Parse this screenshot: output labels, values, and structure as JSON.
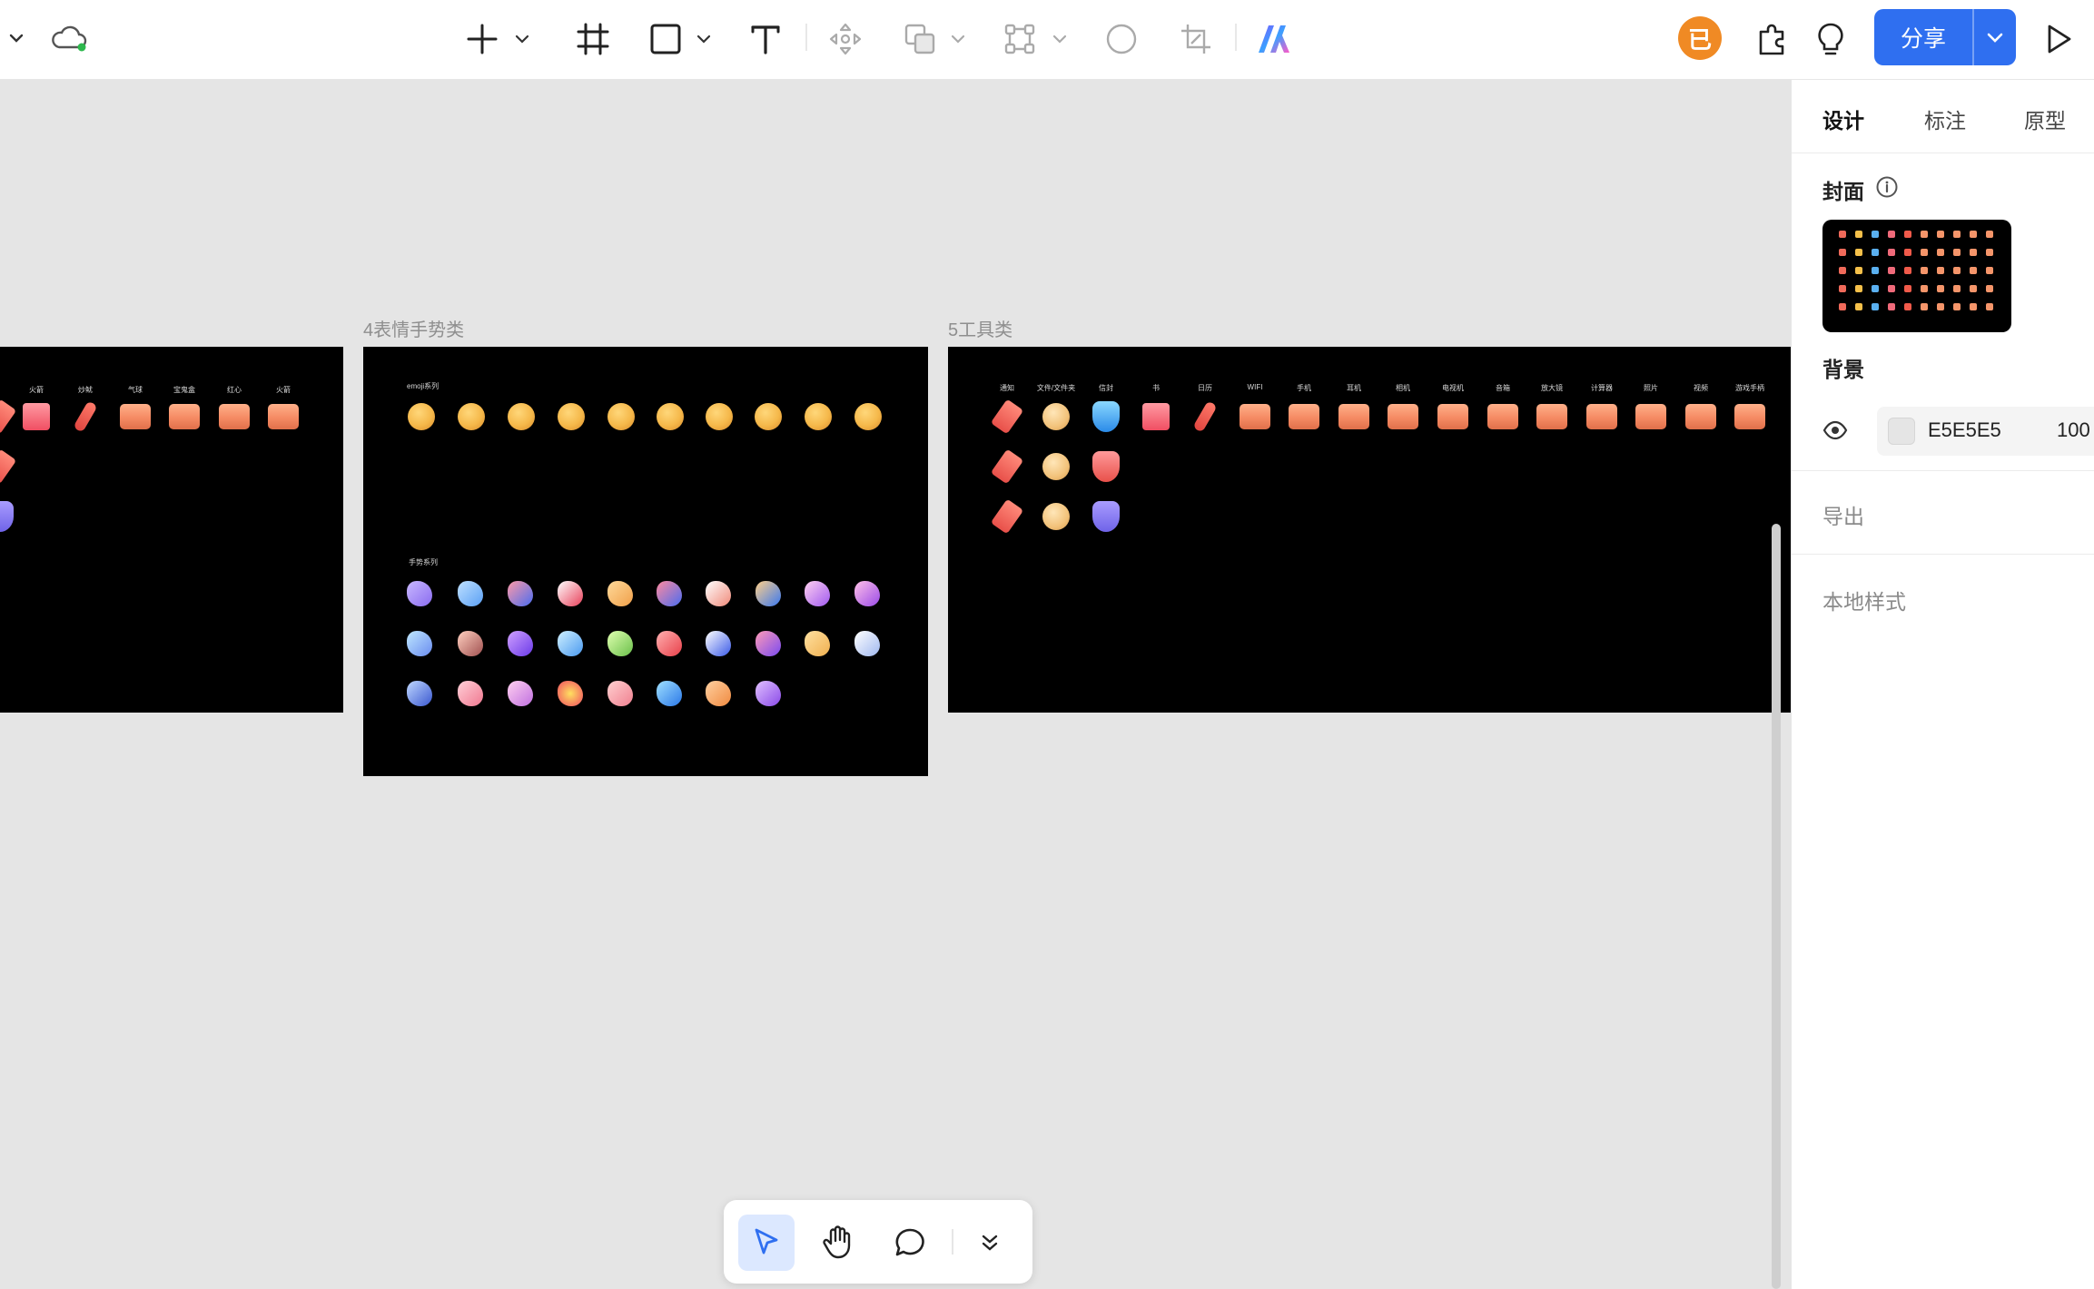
{
  "toolbar": {
    "tools": [
      "chevron-down",
      "cloud-sync",
      "add",
      "frame",
      "rectangle",
      "text",
      "component",
      "boolean",
      "path",
      "ellipse",
      "crop",
      "ai"
    ],
    "avatar_letter": "已",
    "share_label": "分享"
  },
  "frames": [
    {
      "title": "",
      "labels": [
        "火箭",
        "炒鱿",
        "气球",
        "宝鬼盒",
        "红心",
        "火箭"
      ]
    },
    {
      "title": "4表情手势类",
      "section_a": "emoji系列",
      "section_b": "手势系列"
    },
    {
      "title": "5工具类",
      "labels": [
        "通知",
        "文件/文件夹",
        "信封",
        "书",
        "日历",
        "WIFI",
        "手机",
        "耳机",
        "相机",
        "电视机",
        "音箱",
        "放大镜",
        "计算器",
        "照片",
        "视频",
        "游戏手柄"
      ]
    }
  ],
  "panel": {
    "tabs": [
      "设计",
      "标注",
      "原型"
    ],
    "cover_label": "封面",
    "background_label": "背景",
    "background_hex": "E5E5E5",
    "background_opacity": "100",
    "export_label": "导出",
    "local_styles_label": "本地样式"
  },
  "colors": {
    "canvas": "#E5E5E5",
    "accent": "#2F6FF0",
    "avatar": "#F08A24",
    "active_tool_bg": "#DCE8FF"
  }
}
